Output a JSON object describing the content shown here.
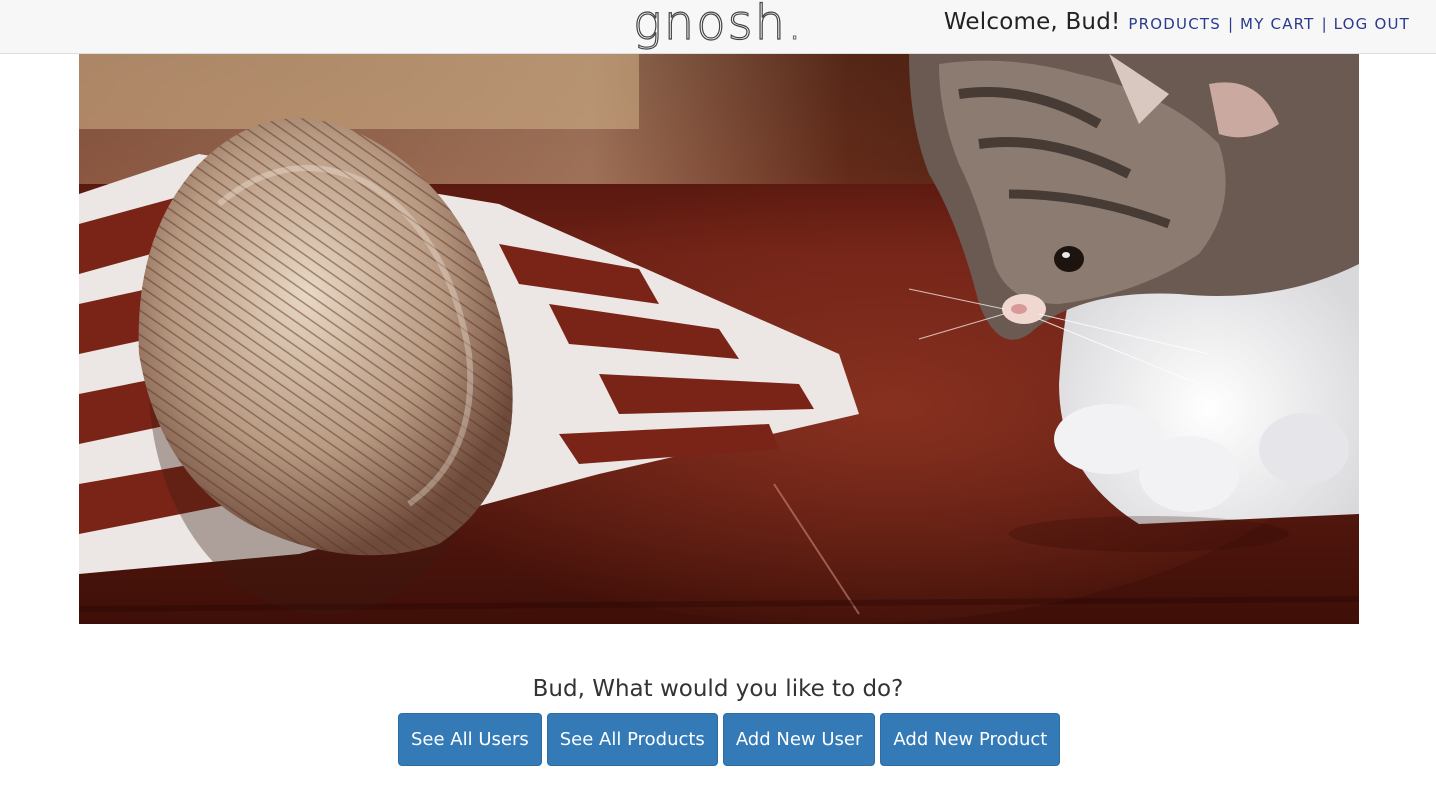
{
  "header": {
    "logo_text": "gnosh",
    "logo_dot": ".",
    "welcome": "Welcome, Bud!",
    "links": [
      "PRODUCTS",
      "MY CART",
      "LOG OUT"
    ],
    "separator": "|"
  },
  "hero": {
    "subject": "hedgehog and kitten on a wooden table"
  },
  "main": {
    "prompt": "Bud, What would you like to do?",
    "buttons": [
      "See All Users",
      "See All Products",
      "Add New User",
      "Add New Product"
    ]
  },
  "colors": {
    "navbar_bg": "#f7f7f7",
    "link": "#2a3a8c",
    "button_bg": "#337ab7",
    "button_border": "#2e6da4"
  }
}
